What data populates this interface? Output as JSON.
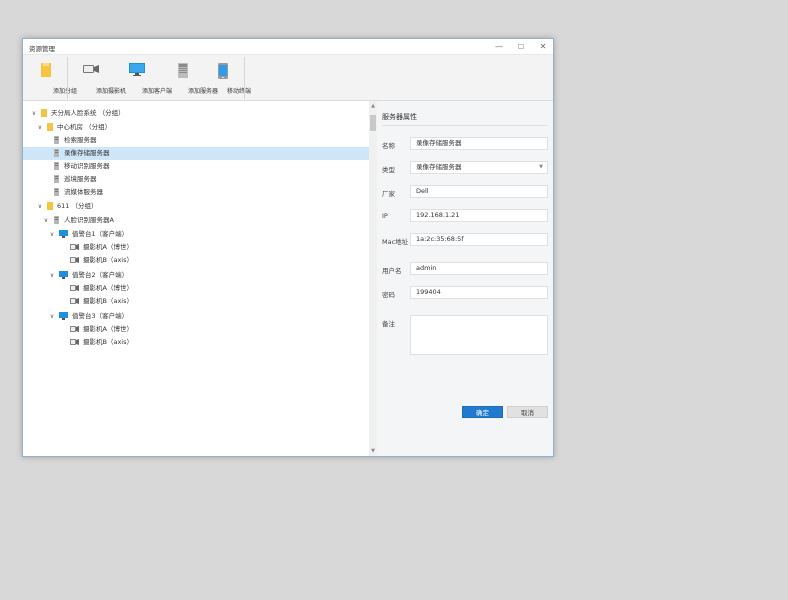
{
  "window": {
    "title": "资源管理"
  },
  "toolbar": {
    "items": [
      {
        "label": "添加分组",
        "icon": "folder-icon"
      },
      {
        "label": "添加摄影机",
        "icon": "camera-icon"
      },
      {
        "label": "添加客户端",
        "icon": "monitor-icon"
      },
      {
        "label": "添加服务器",
        "icon": "server-icon"
      },
      {
        "label": "移动终端",
        "icon": "mobile-icon"
      }
    ]
  },
  "tree": {
    "nodes": [
      {
        "label": "天分局人脸系统 （分组）",
        "icon": "folder-icon",
        "expanded": true
      },
      {
        "label": "中心机房 （分组）",
        "icon": "folder-icon",
        "expanded": true
      },
      {
        "label": "检索服务器",
        "icon": "server-icon"
      },
      {
        "label": "录像存储服务器",
        "icon": "server-icon",
        "selected": true
      },
      {
        "label": "移动识别服务器",
        "icon": "server-icon"
      },
      {
        "label": "巡境服务器",
        "icon": "server-icon"
      },
      {
        "label": "流媒体服务器",
        "icon": "server-icon"
      },
      {
        "label": "611 （分组）",
        "icon": "folder-icon",
        "expanded": true
      },
      {
        "label": "人脸识别服务器A",
        "icon": "server-icon",
        "expanded": true
      },
      {
        "label": "值警台1（客户端）",
        "icon": "monitor-icon",
        "expanded": true
      },
      {
        "label": "摄影机A（博世）",
        "icon": "camera-icon"
      },
      {
        "label": "摄影机B（axis）",
        "icon": "camera-icon"
      },
      {
        "label": "值警台2（客户端）",
        "icon": "monitor-icon",
        "expanded": true
      },
      {
        "label": "摄影机A（博世）",
        "icon": "camera-icon"
      },
      {
        "label": "摄影机B（axis）",
        "icon": "camera-icon"
      },
      {
        "label": "值警台3（客户端）",
        "icon": "monitor-icon",
        "expanded": true
      },
      {
        "label": "摄影机A（博世）",
        "icon": "camera-icon"
      },
      {
        "label": "摄影机B（axis）",
        "icon": "camera-icon"
      }
    ]
  },
  "properties": {
    "title": "服务器属性",
    "name_label": "名称",
    "name_value": "录像存储服务器",
    "type_label": "类型",
    "type_value": "录像存储服务器",
    "vendor_label": "厂家",
    "vendor_value": "Dell",
    "ip_label": "IP",
    "ip_value": "192.168.1.21",
    "mac_label": "Mac地址",
    "mac_value": "1a:2c:35:68:5f",
    "user_label": "用户名",
    "user_value": "admin",
    "password_label": "密码",
    "password_value": "199404",
    "notes_label": "备注",
    "notes_value": "",
    "ok_label": "确定",
    "cancel_label": "取消"
  },
  "colors": {
    "accent": "#1f7ad0",
    "selection": "#cfe5f8",
    "folder": "#f5c542",
    "monitor": "#1e90e0"
  }
}
